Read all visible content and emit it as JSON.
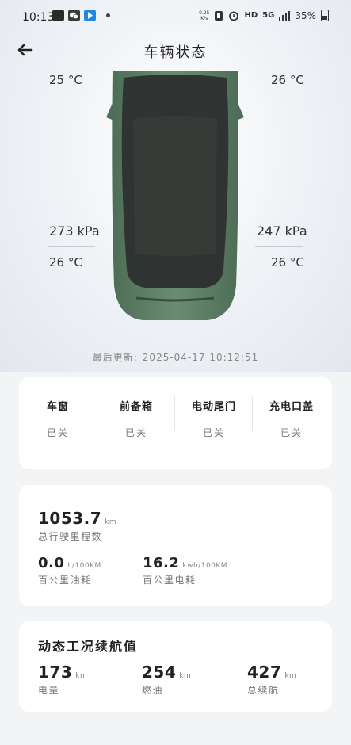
{
  "status_bar": {
    "time": "10:13",
    "network_speed_value": "0.25",
    "network_speed_unit": "K/s",
    "hd": "HD",
    "signal_type": "5G",
    "battery": "35%"
  },
  "header": {
    "title": "车辆状态"
  },
  "tires": {
    "front_left_temp": "25 °C",
    "front_right_temp": "26 °C",
    "rear_left_pressure": "273 kPa",
    "rear_right_pressure": "247 kPa",
    "rear_left_temp": "26 °C",
    "rear_right_temp": "26 °C"
  },
  "last_update": {
    "label": "最后更新:",
    "value": "2025-04-17 10:12:51"
  },
  "openings": [
    {
      "label": "车窗",
      "state": "已关"
    },
    {
      "label": "前备箱",
      "state": "已关"
    },
    {
      "label": "电动尾门",
      "state": "已关"
    },
    {
      "label": "充电口盖",
      "state": "已关"
    }
  ],
  "mileage": {
    "total_value": "1053.7",
    "total_unit": "km",
    "total_label": "总行驶里程数",
    "fuel_value": "0.0",
    "fuel_unit": "L/100KM",
    "fuel_label": "百公里油耗",
    "power_value": "16.2",
    "power_unit": "kwh/100KM",
    "power_label": "百公里电耗"
  },
  "range": {
    "title": "动态工况续航值",
    "electric_value": "173",
    "electric_unit": "km",
    "electric_label": "电量",
    "fuel_value": "254",
    "fuel_unit": "km",
    "fuel_label": "燃油",
    "total_value": "427",
    "total_unit": "km",
    "total_label": "总续航"
  },
  "colors": {
    "car_body": "#5e7f66",
    "car_roof": "#2f3331",
    "card_bg": "#ffffff",
    "page_bg": "#f3f4f6"
  }
}
